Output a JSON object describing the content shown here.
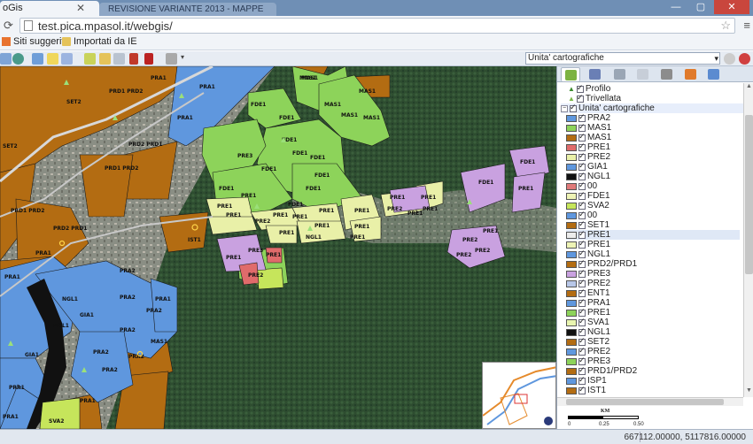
{
  "browser": {
    "active_tab_title": "oGis",
    "inactive_tab_title": "REVISIONE VARIANTE 2013 - MAPPE",
    "url": "test.pica.mpasol.it/webgis/",
    "bookmarks": [
      {
        "label": "Siti suggeriti",
        "icon": "bookmark-site-icon",
        "color": "#e8732f"
      },
      {
        "label": "Importati da IE",
        "icon": "folder-icon",
        "color": "#e5c35a"
      }
    ],
    "window_buttons": [
      "—",
      "▢",
      "✕"
    ]
  },
  "toolbar": {
    "layer_select_value": "Unita' cartografiche",
    "tools": [
      "pan-tool-icon",
      "refresh-icon",
      "layers-tool-icon",
      "note-tool-icon",
      "polygon-tool-icon",
      "zoom-box-tool-icon",
      "move-tool-icon",
      "save-tool-icon",
      "delete-tool-icon",
      "measure-tool-icon"
    ]
  },
  "panel": {
    "tabs": [
      "legend-tab-icon",
      "search-tab-icon",
      "filter-tab-icon",
      "table-tab-icon",
      "print-tab-icon",
      "chart-tab-icon",
      "graph-tab-icon"
    ],
    "tree_top": [
      {
        "label": "Profilo",
        "symbol": "triangle",
        "color": "#3b8b2e"
      },
      {
        "label": "Trivellata",
        "symbol": "triangle",
        "color": "#7ab84a"
      }
    ],
    "group_label": "Unita' cartografiche",
    "layers": [
      {
        "label": "PRA2",
        "color": "#5f97de"
      },
      {
        "label": "MAS1",
        "color": "#8dd35a"
      },
      {
        "label": "MAS1",
        "color": "#b36c12"
      },
      {
        "label": "PRE1",
        "color": "#e06b6b"
      },
      {
        "label": "PRE2",
        "color": "#e9f0a8"
      },
      {
        "label": "GIA1",
        "color": "#5f97de"
      },
      {
        "label": "NGL1",
        "color": "#111111"
      },
      {
        "label": "00",
        "color": "#e07a7a"
      },
      {
        "label": "FDE1",
        "color": "#eef3b5"
      },
      {
        "label": "SVA2",
        "color": "#c6e55b"
      },
      {
        "label": "00",
        "color": "#5f97de"
      },
      {
        "label": "SET1",
        "color": "#b36c12"
      },
      {
        "label": "PRE1",
        "color": "#ececec"
      },
      {
        "label": "PRE1",
        "color": "#eef3b5"
      },
      {
        "label": "NGL1",
        "color": "#5f97de"
      },
      {
        "label": "PRD2/PRD1",
        "color": "#b36c12"
      },
      {
        "label": "PRE3",
        "color": "#c9a1e0"
      },
      {
        "label": "PRE2",
        "color": "#b8c7e8"
      },
      {
        "label": "ENT1",
        "color": "#b36c12"
      },
      {
        "label": "PRA1",
        "color": "#5f97de"
      },
      {
        "label": "PRE1",
        "color": "#8dd35a"
      },
      {
        "label": "SVA1",
        "color": "#e9f5b0"
      },
      {
        "label": "NGL1",
        "color": "#111111"
      },
      {
        "label": "SET2",
        "color": "#b36c12"
      },
      {
        "label": "PRE2",
        "color": "#5f97de"
      },
      {
        "label": "PRE3",
        "color": "#8dd35a"
      },
      {
        "label": "PRD1/PRD2",
        "color": "#b36c12"
      },
      {
        "label": "ISP1",
        "color": "#5f97de"
      },
      {
        "label": "IST1",
        "color": "#b36c12"
      }
    ],
    "selected_layer_index": 12,
    "scale": {
      "unit": "KM",
      "ticks": [
        "0",
        "0.25",
        "0.50"
      ]
    }
  },
  "map": {
    "labels_orange": [
      "PRD1 PRD2",
      "SET2",
      "PRA1",
      "PRD2 PRD1",
      "SET2",
      "PRD1 PRD2",
      "PRD1 PRD2",
      "PRD2 PRD1",
      "IST1",
      "MAS1",
      "MAS1",
      "MAS1"
    ],
    "labels_blue": [
      "PRA1",
      "PRA1",
      "PRA1",
      "PRA2",
      "NGL1",
      "GIA1",
      "NGL1",
      "PRA1",
      "PRA2",
      "PRA2",
      "PRA2",
      "GIA1",
      "PRA1",
      "PRA2",
      "PRA2",
      "PRA2",
      "PRA1",
      "PRA1",
      "PRA1"
    ],
    "labels_green": [
      "MAS1",
      "MAS1",
      "MAS1",
      "MAS1",
      "FDE1",
      "FDE1",
      "FDE1",
      "PRE3",
      "FDE1",
      "FDE1",
      "FDE1",
      "FDE1",
      "FDE1"
    ],
    "labels_yellow": [
      "FDE1",
      "PRE1",
      "PRE1",
      "PRE2",
      "PRE1",
      "PRE1",
      "PRE1",
      "PRE1",
      "PRE1",
      "PRE1",
      "PRE2",
      "PRE1",
      "PRE1",
      "PRE1",
      "PRE1",
      "PRE1",
      "FDE1",
      "PRE1",
      "PRE1",
      "PRE2",
      "SVA2",
      "NGL1"
    ],
    "labels_purple": [
      "FDE1",
      "FDE1",
      "PRE2",
      "PRE2",
      "PRE3",
      "PRE1",
      "PRE2",
      "PRE1",
      "PRE1",
      "PRE1"
    ]
  },
  "status": {
    "coordinates": "667112.00000, 5117816.00000"
  }
}
